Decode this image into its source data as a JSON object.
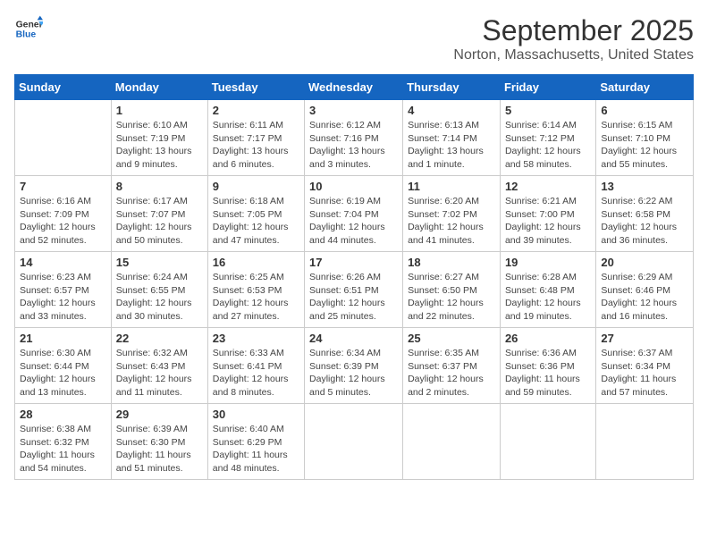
{
  "logo": {
    "line1": "General",
    "line2": "Blue"
  },
  "title": "September 2025",
  "location": "Norton, Massachusetts, United States",
  "weekdays": [
    "Sunday",
    "Monday",
    "Tuesday",
    "Wednesday",
    "Thursday",
    "Friday",
    "Saturday"
  ],
  "weeks": [
    [
      {
        "day": "",
        "info": ""
      },
      {
        "day": "1",
        "info": "Sunrise: 6:10 AM\nSunset: 7:19 PM\nDaylight: 13 hours\nand 9 minutes."
      },
      {
        "day": "2",
        "info": "Sunrise: 6:11 AM\nSunset: 7:17 PM\nDaylight: 13 hours\nand 6 minutes."
      },
      {
        "day": "3",
        "info": "Sunrise: 6:12 AM\nSunset: 7:16 PM\nDaylight: 13 hours\nand 3 minutes."
      },
      {
        "day": "4",
        "info": "Sunrise: 6:13 AM\nSunset: 7:14 PM\nDaylight: 13 hours\nand 1 minute."
      },
      {
        "day": "5",
        "info": "Sunrise: 6:14 AM\nSunset: 7:12 PM\nDaylight: 12 hours\nand 58 minutes."
      },
      {
        "day": "6",
        "info": "Sunrise: 6:15 AM\nSunset: 7:10 PM\nDaylight: 12 hours\nand 55 minutes."
      }
    ],
    [
      {
        "day": "7",
        "info": "Sunrise: 6:16 AM\nSunset: 7:09 PM\nDaylight: 12 hours\nand 52 minutes."
      },
      {
        "day": "8",
        "info": "Sunrise: 6:17 AM\nSunset: 7:07 PM\nDaylight: 12 hours\nand 50 minutes."
      },
      {
        "day": "9",
        "info": "Sunrise: 6:18 AM\nSunset: 7:05 PM\nDaylight: 12 hours\nand 47 minutes."
      },
      {
        "day": "10",
        "info": "Sunrise: 6:19 AM\nSunset: 7:04 PM\nDaylight: 12 hours\nand 44 minutes."
      },
      {
        "day": "11",
        "info": "Sunrise: 6:20 AM\nSunset: 7:02 PM\nDaylight: 12 hours\nand 41 minutes."
      },
      {
        "day": "12",
        "info": "Sunrise: 6:21 AM\nSunset: 7:00 PM\nDaylight: 12 hours\nand 39 minutes."
      },
      {
        "day": "13",
        "info": "Sunrise: 6:22 AM\nSunset: 6:58 PM\nDaylight: 12 hours\nand 36 minutes."
      }
    ],
    [
      {
        "day": "14",
        "info": "Sunrise: 6:23 AM\nSunset: 6:57 PM\nDaylight: 12 hours\nand 33 minutes."
      },
      {
        "day": "15",
        "info": "Sunrise: 6:24 AM\nSunset: 6:55 PM\nDaylight: 12 hours\nand 30 minutes."
      },
      {
        "day": "16",
        "info": "Sunrise: 6:25 AM\nSunset: 6:53 PM\nDaylight: 12 hours\nand 27 minutes."
      },
      {
        "day": "17",
        "info": "Sunrise: 6:26 AM\nSunset: 6:51 PM\nDaylight: 12 hours\nand 25 minutes."
      },
      {
        "day": "18",
        "info": "Sunrise: 6:27 AM\nSunset: 6:50 PM\nDaylight: 12 hours\nand 22 minutes."
      },
      {
        "day": "19",
        "info": "Sunrise: 6:28 AM\nSunset: 6:48 PM\nDaylight: 12 hours\nand 19 minutes."
      },
      {
        "day": "20",
        "info": "Sunrise: 6:29 AM\nSunset: 6:46 PM\nDaylight: 12 hours\nand 16 minutes."
      }
    ],
    [
      {
        "day": "21",
        "info": "Sunrise: 6:30 AM\nSunset: 6:44 PM\nDaylight: 12 hours\nand 13 minutes."
      },
      {
        "day": "22",
        "info": "Sunrise: 6:32 AM\nSunset: 6:43 PM\nDaylight: 12 hours\nand 11 minutes."
      },
      {
        "day": "23",
        "info": "Sunrise: 6:33 AM\nSunset: 6:41 PM\nDaylight: 12 hours\nand 8 minutes."
      },
      {
        "day": "24",
        "info": "Sunrise: 6:34 AM\nSunset: 6:39 PM\nDaylight: 12 hours\nand 5 minutes."
      },
      {
        "day": "25",
        "info": "Sunrise: 6:35 AM\nSunset: 6:37 PM\nDaylight: 12 hours\nand 2 minutes."
      },
      {
        "day": "26",
        "info": "Sunrise: 6:36 AM\nSunset: 6:36 PM\nDaylight: 11 hours\nand 59 minutes."
      },
      {
        "day": "27",
        "info": "Sunrise: 6:37 AM\nSunset: 6:34 PM\nDaylight: 11 hours\nand 57 minutes."
      }
    ],
    [
      {
        "day": "28",
        "info": "Sunrise: 6:38 AM\nSunset: 6:32 PM\nDaylight: 11 hours\nand 54 minutes."
      },
      {
        "day": "29",
        "info": "Sunrise: 6:39 AM\nSunset: 6:30 PM\nDaylight: 11 hours\nand 51 minutes."
      },
      {
        "day": "30",
        "info": "Sunrise: 6:40 AM\nSunset: 6:29 PM\nDaylight: 11 hours\nand 48 minutes."
      },
      {
        "day": "",
        "info": ""
      },
      {
        "day": "",
        "info": ""
      },
      {
        "day": "",
        "info": ""
      },
      {
        "day": "",
        "info": ""
      }
    ]
  ]
}
